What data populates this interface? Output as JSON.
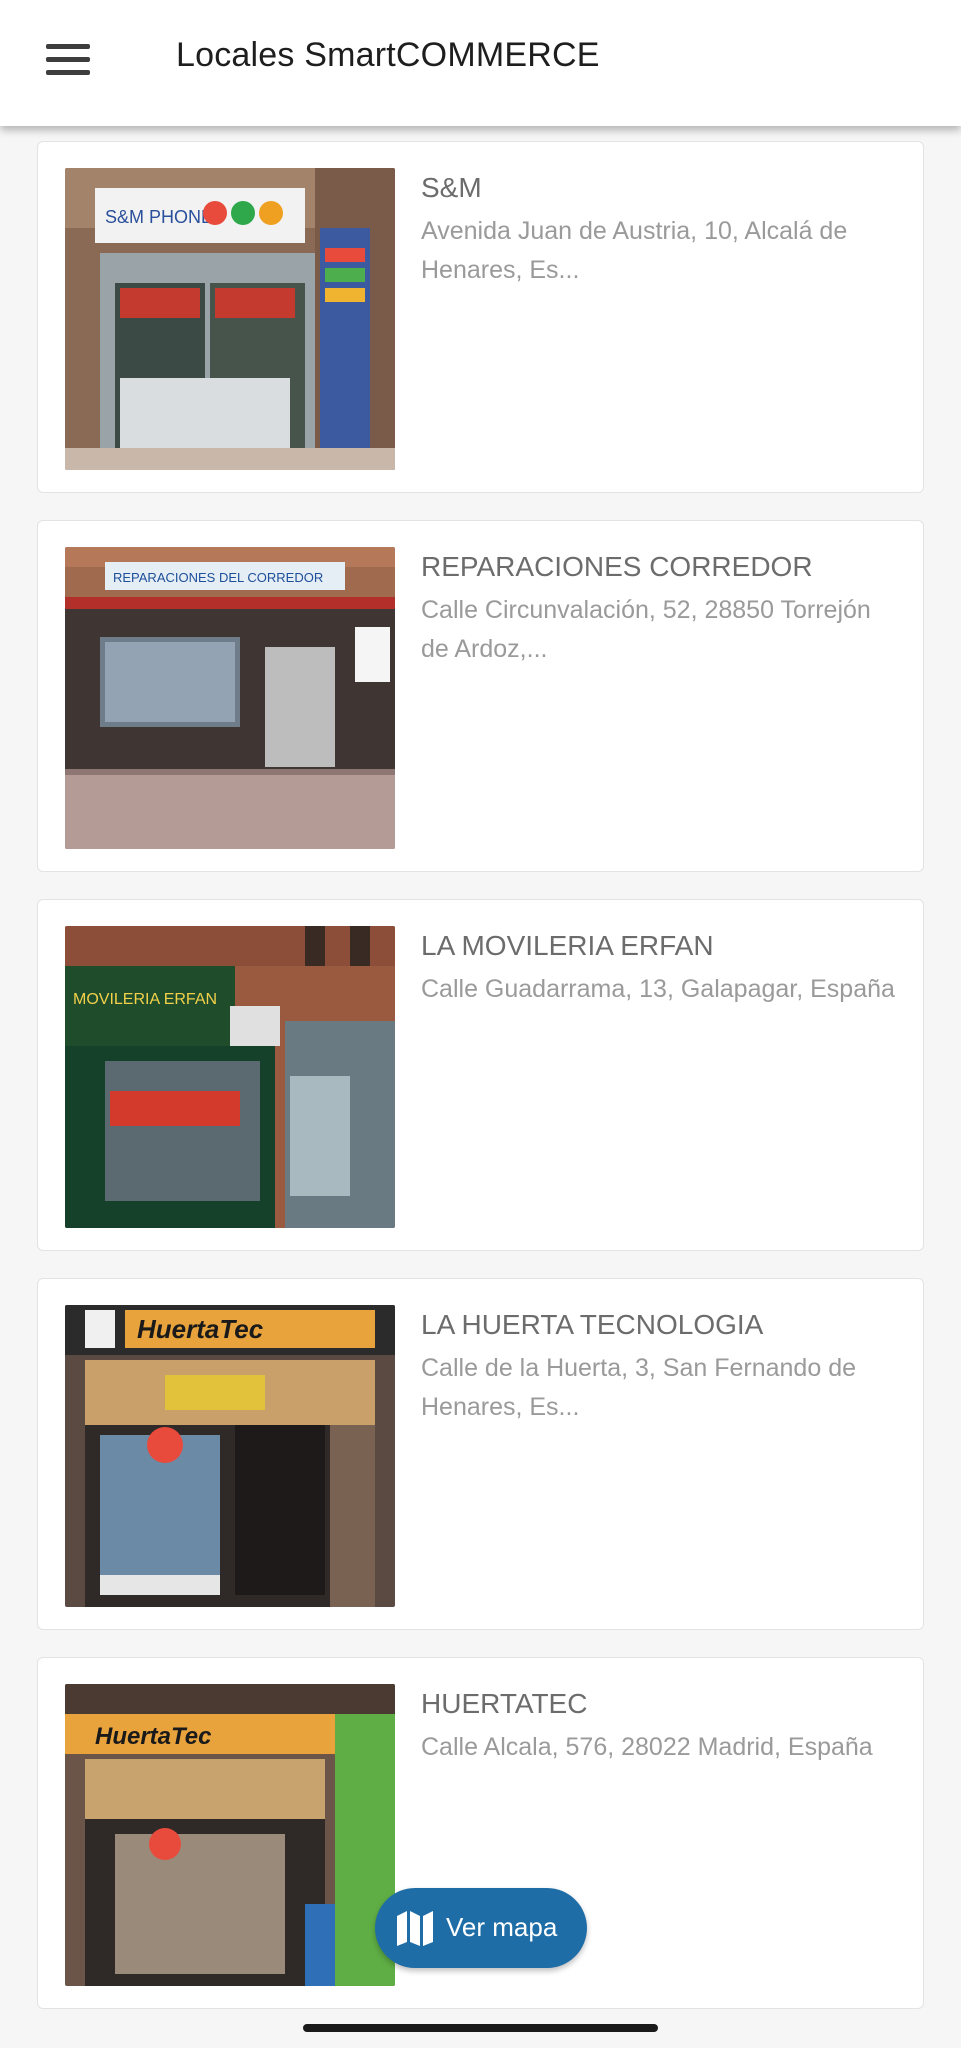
{
  "header": {
    "title": "Locales SmartCOMMERCE",
    "menu_icon": "hamburger-menu-icon"
  },
  "stores": [
    {
      "name": "S&M",
      "address": "Avenida Juan de Austria, 10, Alcalá de Henares, Es...",
      "photo_signage": "S&M PHONE"
    },
    {
      "name": "REPARACIONES CORREDOR",
      "address": "Calle Circunvalación, 52, 28850 Torrejón de Ardoz,...",
      "photo_signage": "REPARACIONES DEL CORREDOR"
    },
    {
      "name": "LA MOVILERIA ERFAN",
      "address": "Calle Guadarrama, 13, Galapagar, España",
      "photo_signage": "MOVILERIA ERFAN"
    },
    {
      "name": "LA HUERTA TECNOLOGIA",
      "address": "Calle de la Huerta, 3, San Fernando de Henares, Es...",
      "photo_signage": "HuertaTec"
    },
    {
      "name": "HUERTATEC",
      "address": "Calle Alcala, 576, 28022 Madrid, España",
      "photo_signage": "HuertaTec"
    }
  ],
  "map_button": {
    "label": "Ver mapa",
    "icon": "map-icon"
  },
  "colors": {
    "primary": "#1f6da6",
    "background": "#f6f6f6",
    "card": "#ffffff",
    "name_text": "#6c6c6c",
    "address_text": "#9a9a9a"
  }
}
